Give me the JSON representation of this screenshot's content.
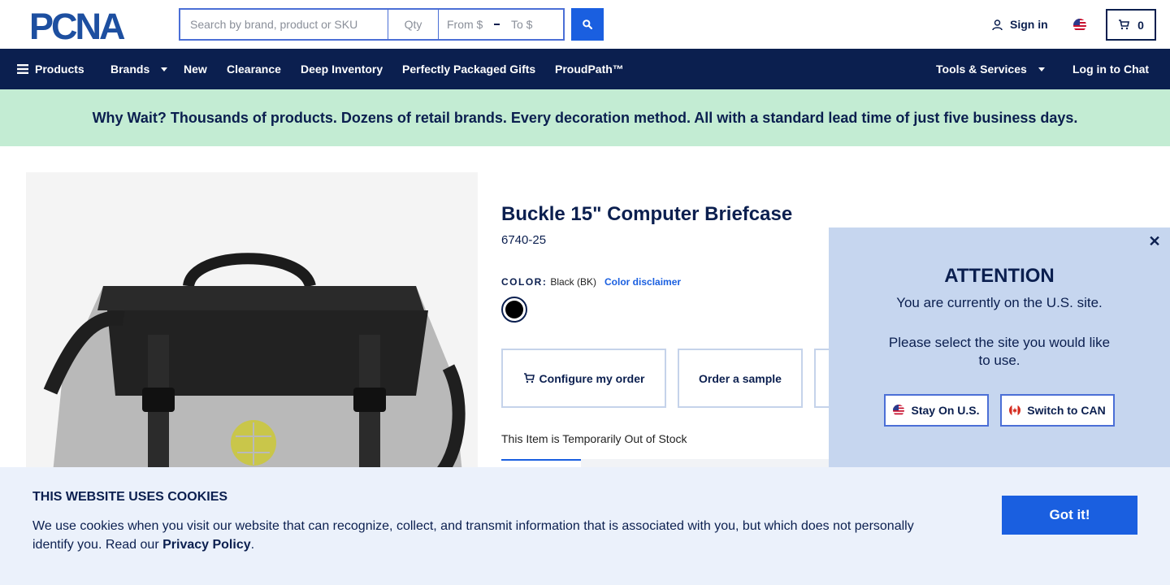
{
  "header": {
    "logo_text": "PCNA",
    "search_placeholder": "Search by brand, product or SKU",
    "qty_placeholder": "Qty",
    "from_placeholder": "From $",
    "to_placeholder": "To $",
    "signin_label": "Sign in",
    "cart_count": "0"
  },
  "nav": {
    "products": "Products",
    "brands": "Brands",
    "new": "New",
    "clearance": "Clearance",
    "deep_inventory": "Deep Inventory",
    "gifts": "Perfectly Packaged Gifts",
    "proudpath": "ProudPath™",
    "tools": "Tools & Services",
    "chat": "Log in to Chat"
  },
  "promo": {
    "text": "Why Wait? Thousands of products. Dozens of retail brands. Every decoration method. All with a standard lead time of just five business days."
  },
  "product": {
    "title": "Buckle 15\" Computer Briefcase",
    "sku": "6740-25",
    "color_label": "COLOR:",
    "color_value": "Black (BK)",
    "color_disclaimer": "Color disclaimer",
    "swatch_color": "#000000",
    "configure_label": "Configure my order",
    "sample_label": "Order a sample",
    "stock_status": "This Item is Temporarily Out of Stock"
  },
  "modal": {
    "title": "ATTENTION",
    "line1": "You are currently on the U.S. site.",
    "line2": "Please select the site you would like to use.",
    "stay_label": "Stay On U.S.",
    "switch_label": "Switch to CAN"
  },
  "cookie": {
    "title": "THIS WEBSITE USES COOKIES",
    "text": "We use cookies when you visit our website that can recognize, collect, and transmit information that is associated with you, but which does not personally identify you. Read our ",
    "link_label": "Privacy Policy",
    "period": ".",
    "button_label": "Got it!"
  },
  "colors": {
    "navy": "#0b1f4f",
    "accent_blue": "#1a5fe0",
    "promo_green": "#c3ecd3",
    "modal_bg": "#c6d6ef",
    "cookie_bg": "#ebf1fb"
  }
}
